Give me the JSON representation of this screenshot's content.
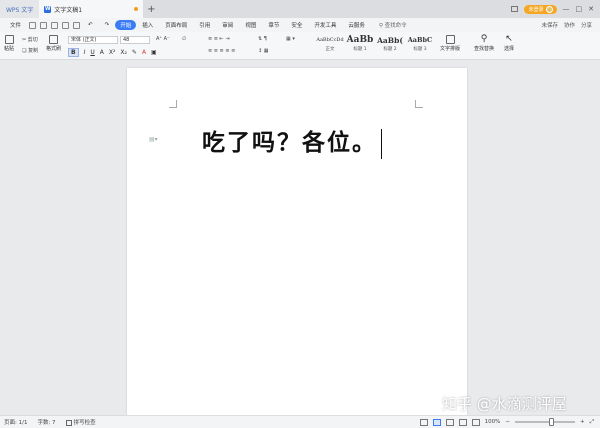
{
  "titlebar": {
    "app_tab": "WPS 文字",
    "doc_tab": "文字文稿1",
    "new_tab": "+",
    "login_label": "未登录"
  },
  "menubar": {
    "file": "文件",
    "tabs": [
      {
        "label": "开始"
      },
      {
        "label": "插入"
      },
      {
        "label": "页面布局"
      },
      {
        "label": "引用"
      },
      {
        "label": "审阅"
      },
      {
        "label": "视图"
      },
      {
        "label": "章节"
      },
      {
        "label": "安全"
      },
      {
        "label": "开发工具"
      },
      {
        "label": "云服务"
      }
    ],
    "search": "查找命令",
    "unsaved": "未保存",
    "collab": "协作",
    "share": "分享"
  },
  "ribbon": {
    "paste": "粘贴",
    "cut": "剪切",
    "copy": "复制",
    "format_painter": "格式刷",
    "font_name": "宋体 (正文)",
    "font_size": "48",
    "styles": [
      {
        "preview": "AaBbCcDd",
        "label": "正文"
      },
      {
        "preview": "AaBb",
        "label": "标题 1"
      },
      {
        "preview": "AaBb(",
        "label": "标题 2"
      },
      {
        "preview": "AaBbC",
        "label": "标题 3"
      }
    ],
    "text_tools": "文字排版",
    "find_replace": "查找替换",
    "select": "选择"
  },
  "document": {
    "text": "吃了吗？各位。"
  },
  "statusbar": {
    "page": "页面: 1/1",
    "words": "字数: 7",
    "spell": "拼写检查",
    "zoom": "100%"
  },
  "watermark": "知乎 @水滴测评屋",
  "colors": {
    "accent": "#3b7cf5",
    "login": "#f5a623",
    "canvas": "#e9eaec"
  }
}
